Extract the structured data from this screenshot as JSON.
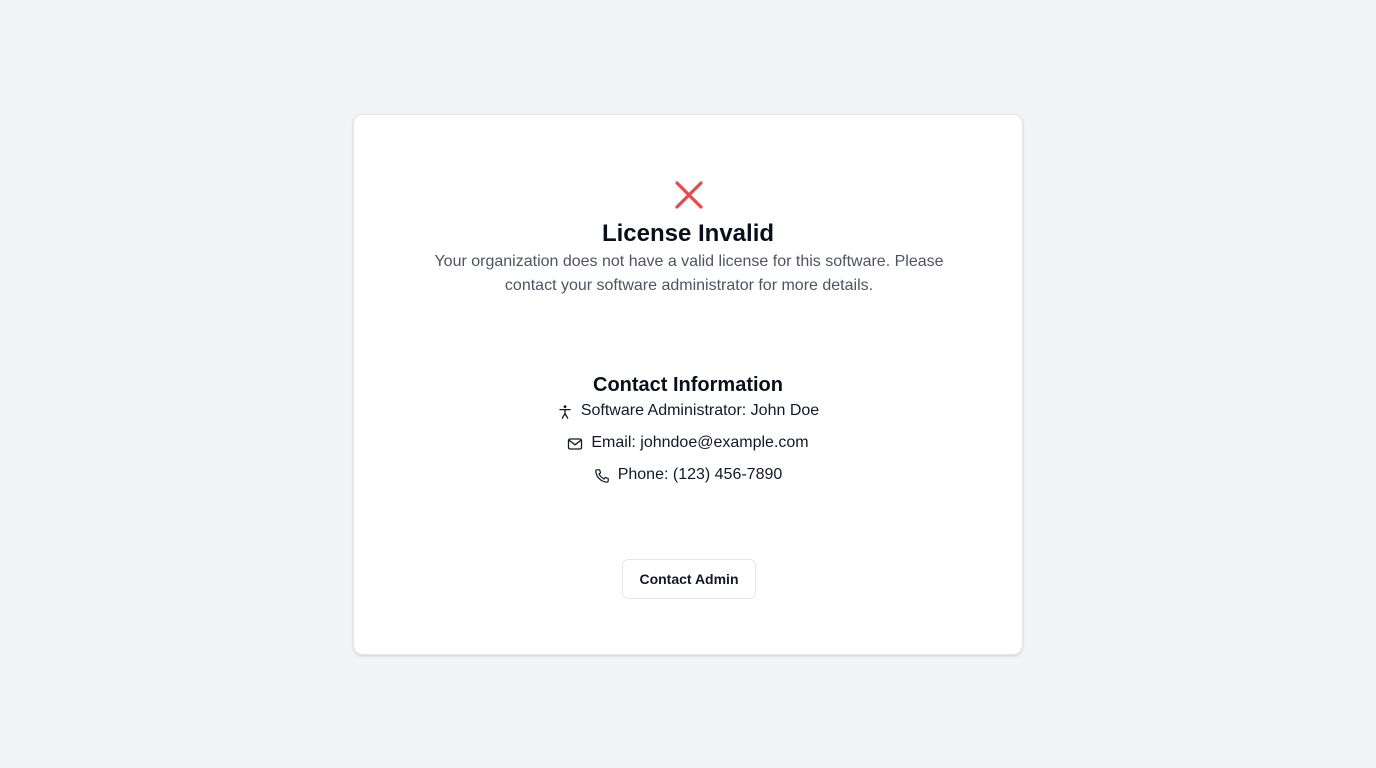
{
  "status": {
    "icon": "x-icon",
    "icon_color": "#e5484d",
    "title": "License Invalid",
    "description": "Your organization does not have a valid license for this software. Please contact your software administrator for more details."
  },
  "contact": {
    "heading": "Contact Information",
    "admin": {
      "icon": "accessibility-person-icon",
      "text": "Software Administrator: John Doe"
    },
    "email": {
      "icon": "mail-icon",
      "text": "Email: johndoe@example.com"
    },
    "phone": {
      "icon": "phone-icon",
      "text": "Phone: (123) 456-7890"
    }
  },
  "actions": {
    "contact_admin_label": "Contact Admin"
  }
}
